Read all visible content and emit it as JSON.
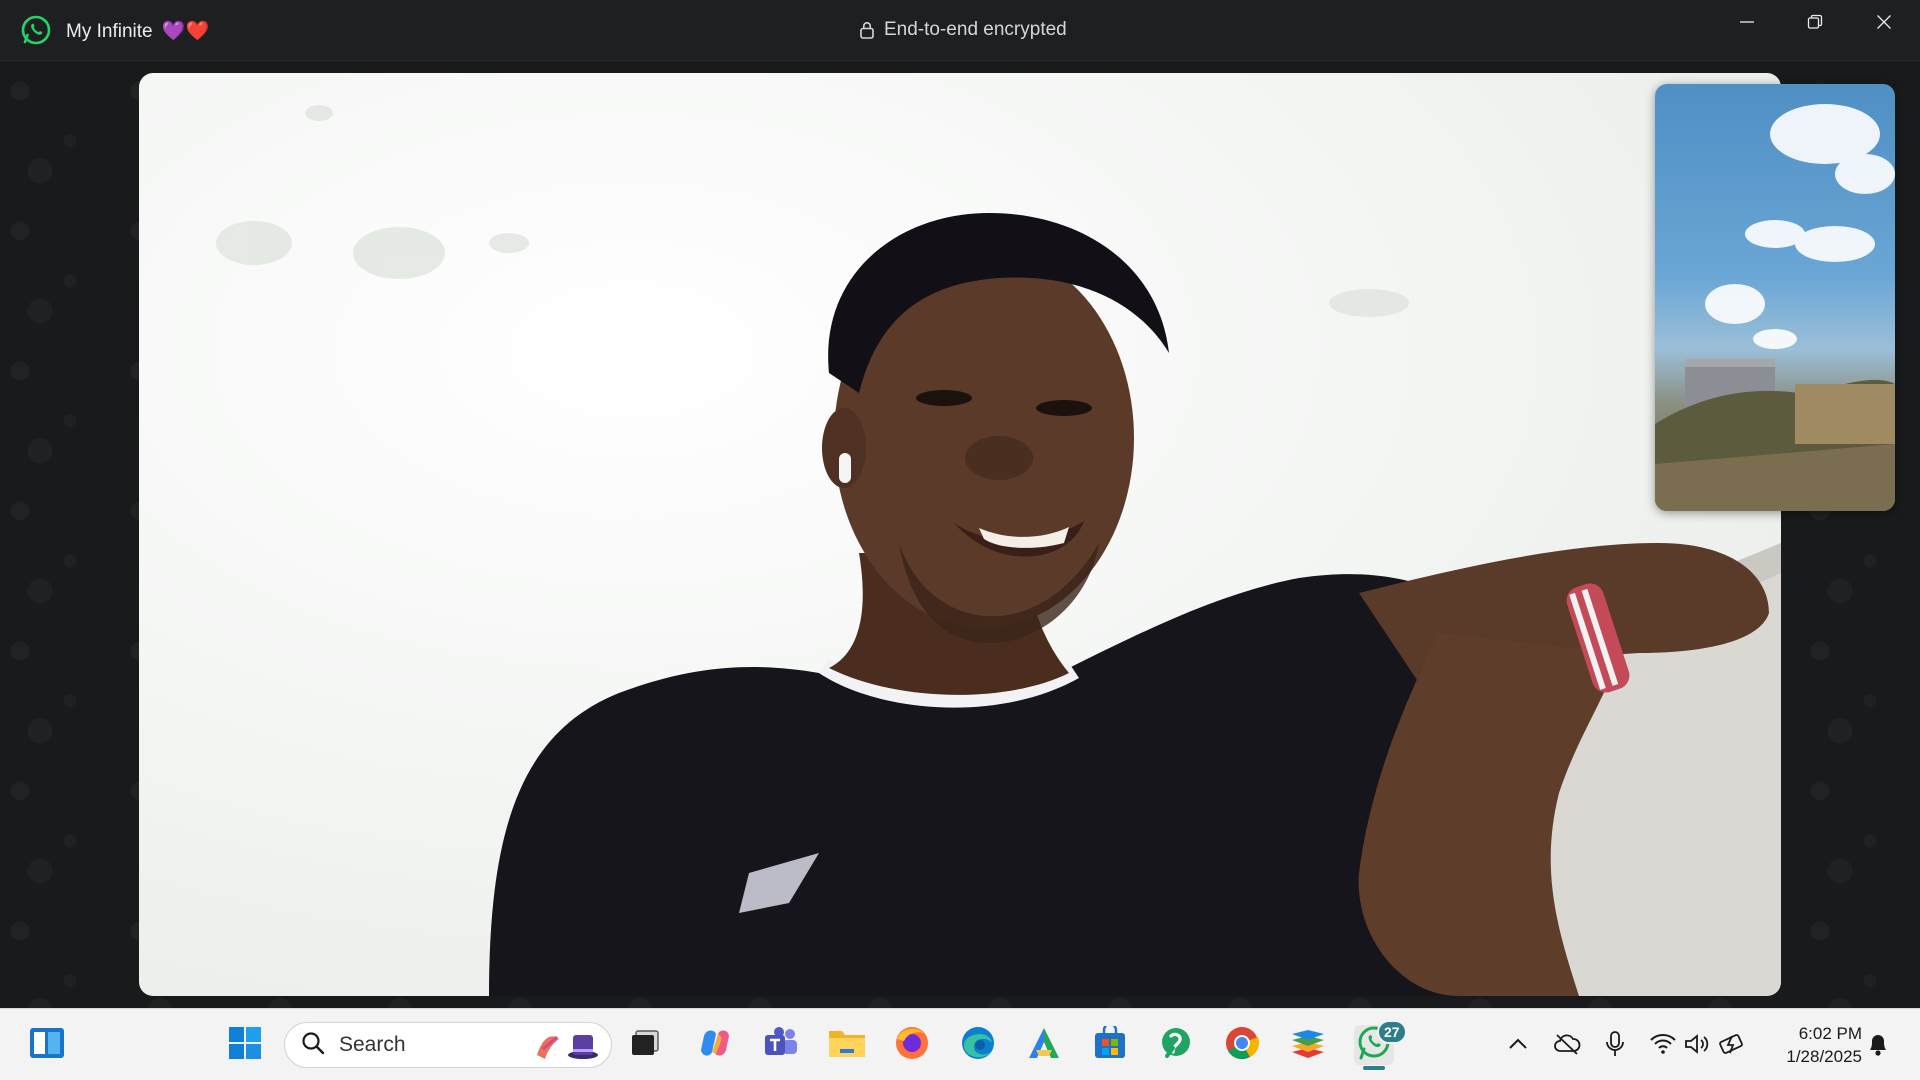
{
  "titlebar": {
    "contact_name": "My Infinite",
    "hearts": "💜❤️",
    "encryption_label": "End-to-end encrypted"
  },
  "window_controls": [
    "minimize-icon",
    "restore-icon",
    "close-icon"
  ],
  "call": {
    "remote_video": "remote-participant-video",
    "self_view": "self-preview-video"
  },
  "taskbar": {
    "search_placeholder": "Search",
    "pinned_apps": [
      "task-view",
      "copilot",
      "teams",
      "file-explorer",
      "firefox",
      "edge",
      "app-a",
      "microsoft-store",
      "app-green",
      "chrome",
      "bluestacks",
      "whatsapp"
    ],
    "whatsapp_badge": "27",
    "accent_color": "#2c7e8a"
  },
  "tray": {
    "time": "6:02 PM",
    "date": "1/28/2025"
  }
}
